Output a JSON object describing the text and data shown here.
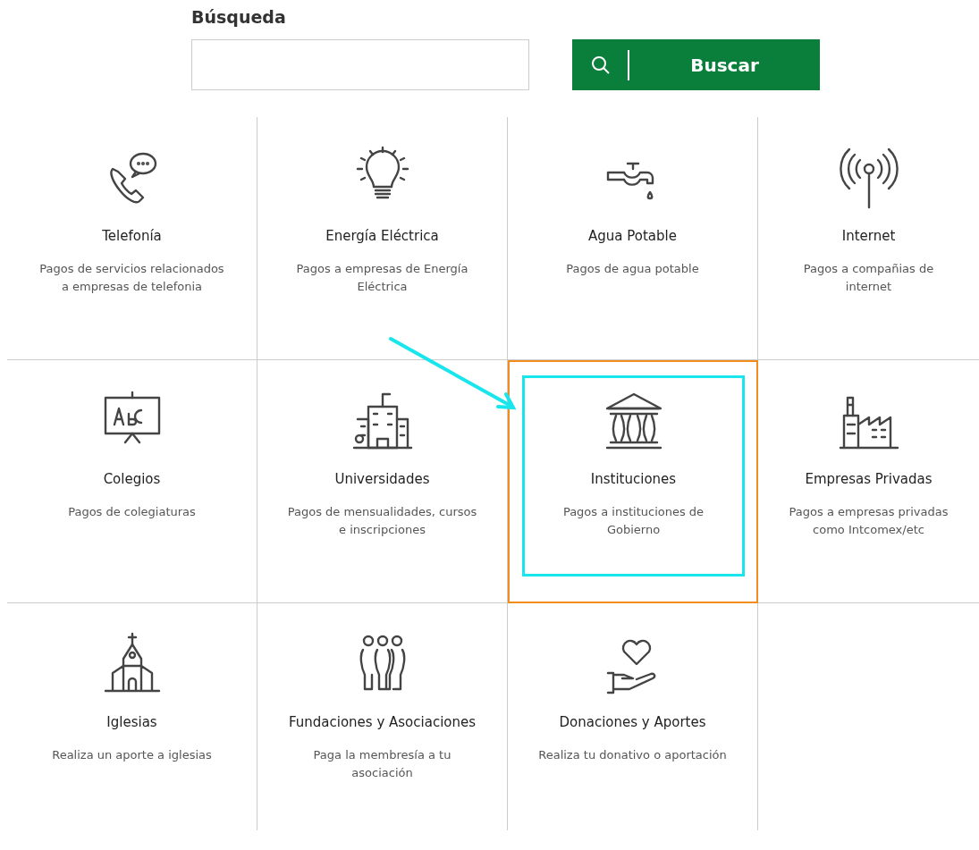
{
  "search": {
    "label": "Búsqueda",
    "button": "Buscar"
  },
  "categories": [
    {
      "title": "Telefonía",
      "description": "Pagos de servicios relacionados a empresas de telefonia",
      "highlighted": false
    },
    {
      "title": "Energía Eléctrica",
      "description": "Pagos a empresas de Energía Eléctrica",
      "highlighted": false
    },
    {
      "title": "Agua Potable",
      "description": "Pagos de agua potable",
      "highlighted": false
    },
    {
      "title": "Internet",
      "description": "Pagos a compañias de internet",
      "highlighted": false
    },
    {
      "title": "Colegios",
      "description": "Pagos de colegiaturas",
      "highlighted": false
    },
    {
      "title": "Universidades",
      "description": "Pagos de mensualidades, cursos e inscripciones",
      "highlighted": false
    },
    {
      "title": "Instituciones",
      "description": "Pagos a instituciones de Gobierno",
      "highlighted": true
    },
    {
      "title": "Empresas Privadas",
      "description": "Pagos a empresas privadas como Intcomex/etc",
      "highlighted": false
    },
    {
      "title": "Iglesias",
      "description": "Realiza un aporte a iglesias",
      "highlighted": false
    },
    {
      "title": "Fundaciones y Asociaciones",
      "description": "Paga la membresía a tu asociación",
      "highlighted": false
    },
    {
      "title": "Donaciones y Aportes",
      "description": "Realiza tu donativo o aportación",
      "highlighted": false
    }
  ]
}
